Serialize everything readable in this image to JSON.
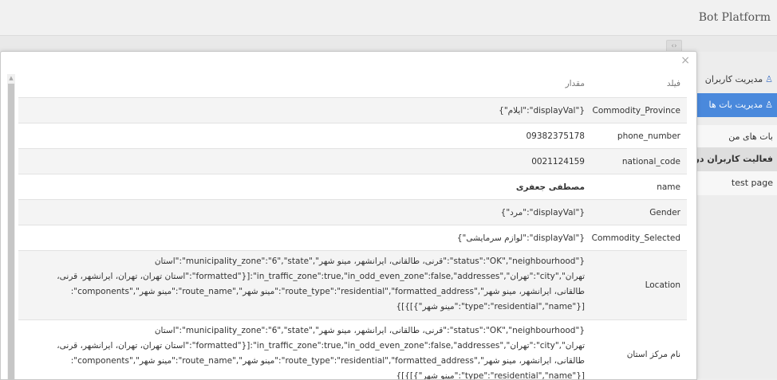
{
  "header": {
    "brand": "Bot Platform"
  },
  "subbar": {
    "collapse_label": "‹›"
  },
  "sidebar": {
    "items": [
      {
        "label": "مدیریت کاربران",
        "icon": "user-icon"
      },
      {
        "label": "مدیریت بات ها",
        "icon": "user-icon"
      },
      {
        "label": "بات های من"
      },
      {
        "label": "فعالیت کاربران در بات"
      },
      {
        "label": "test page"
      }
    ]
  },
  "modal": {
    "close_label": "×",
    "table": {
      "headers": {
        "field": "فیلد",
        "value": "مقدار"
      },
      "rows": [
        {
          "field": "Commodity_Province",
          "value": "{\"displayVal\":\"ایلام\"}"
        },
        {
          "field": "phone_number",
          "value": "09382375178"
        },
        {
          "field": "national_code",
          "value": "0021124159"
        },
        {
          "field": "name",
          "value": "مصطفی جعفری"
        },
        {
          "field": "Gender",
          "value": "{\"displayVal\":\"مرد\"}"
        },
        {
          "field": "Commodity_Selected",
          "value": "{\"displayVal\":\"لوازم سرمایشی\"}"
        },
        {
          "field": "Location",
          "value": "{\"status\":\"OK\",\"neighbourhood\":\"قرنی، طالقانی، ایرانشهر، مینو شهر\",\"municipality_zone\":\"6\",\"state\":\"استان تهران\",\"city\":\"تهران\",\"in_traffic_zone\":true,\"in_odd_even_zone\":false,\"addresses\":[{\"formatted\":\"استان تهران، تهران، ایرانشهر، قرنی، طالقانی، ایرانشهر، مینو شهر\",\"route_type\":\"residential\",\"formatted_address\":\"مینو شهر\",\"route_name\":\"مینو شهر\",\"components\":[{\"type\":\"residential\",\"name\":\"مینو شهر\"}]}]}"
        },
        {
          "field": "نام مرکز استان",
          "value": "{\"status\":\"OK\",\"neighbourhood\":\"قرنی، طالقانی، ایرانشهر، مینو شهر\",\"municipality_zone\":\"6\",\"state\":\"استان تهران\",\"city\":\"تهران\",\"in_traffic_zone\":true,\"in_odd_even_zone\":false,\"addresses\":[{\"formatted\":\"استان تهران، تهران، ایرانشهر، قرنی، طالقانی، ایرانشهر، مینو شهر\",\"route_type\":\"residential\",\"formatted_address\":\"مینو شهر\",\"route_name\":\"مینو شهر\",\"components\":[{\"type\":\"residential\",\"name\":\"مینو شهر\"}]}]}"
        }
      ]
    }
  }
}
